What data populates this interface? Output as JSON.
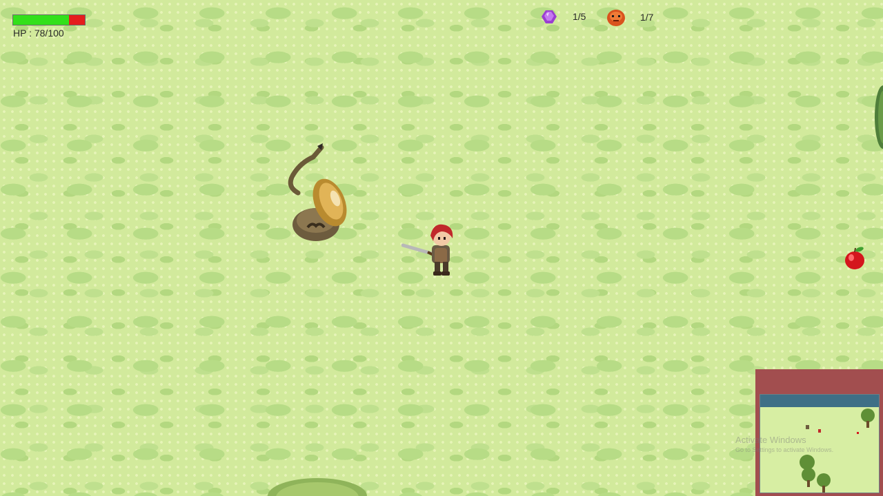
{
  "hud": {
    "hp_label": "HP : 78/100",
    "hp_current": 78,
    "hp_max": 100,
    "hp_fill_color": "#33e01a",
    "hp_empty_color": "#e41d1d",
    "gem_count": "1/5",
    "gem_icon": "purple-gem-icon",
    "enemy_count": "1/7",
    "enemy_icon": "orange-enemy-face-icon"
  },
  "world": {
    "enemy": "scorpion-slime-enemy",
    "player": "red-haired-swordsman-player",
    "pickup": "red-apple-icon"
  },
  "overlay": {
    "watermark_title": "Activate Windows",
    "watermark_sub": "Go to Settings to activate Windows."
  }
}
